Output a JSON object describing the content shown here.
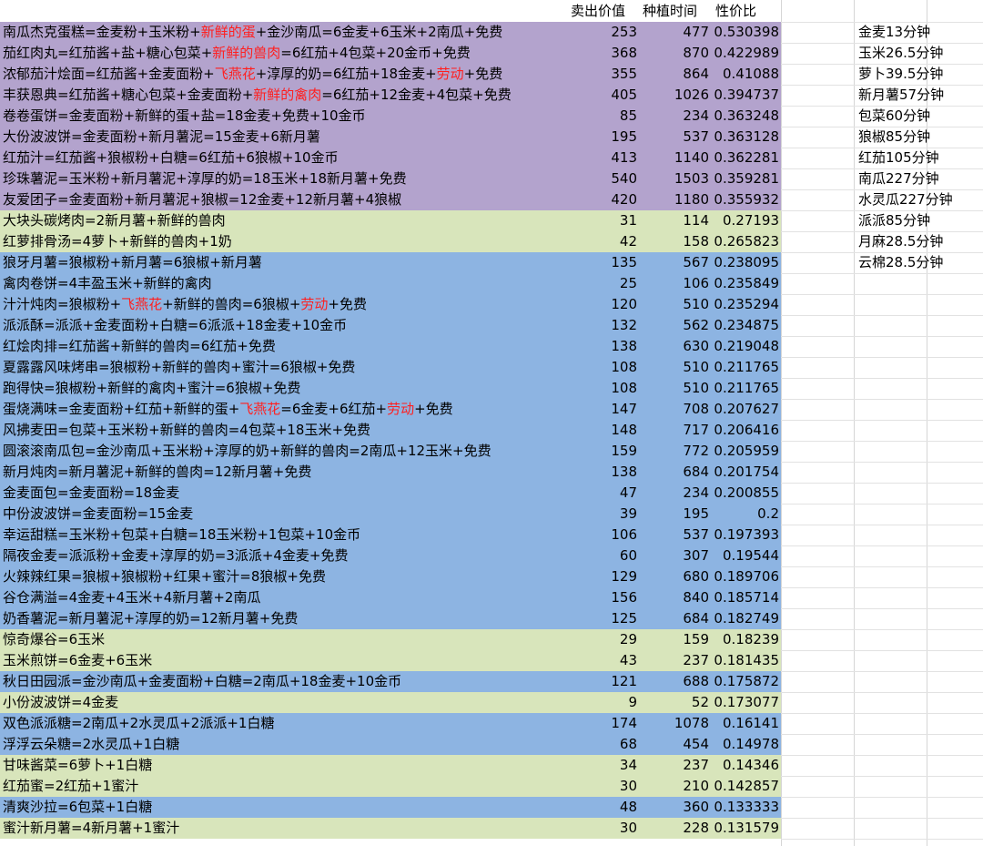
{
  "colors": {
    "purple": "#b3a3cd",
    "green": "#d8e5bb",
    "blue": "#8db4e2",
    "highlight_text": "#ff1f1f",
    "grid": "#d6d6d6"
  },
  "headers": {
    "price": "卖出价值",
    "time": "种植时间",
    "ratio": "性价比"
  },
  "rows": [
    {
      "color": "purple",
      "segments": [
        {
          "t": "南瓜杰克蛋糕=金麦粉+玉米粉+"
        },
        {
          "t": "新鲜的蛋",
          "red": true
        },
        {
          "t": "+金沙南瓜=6金麦+6玉米+2南瓜+免费"
        }
      ],
      "price": "253",
      "time": "477",
      "ratio": "0.530398"
    },
    {
      "color": "purple",
      "segments": [
        {
          "t": "茄红肉丸=红茄酱+盐+糖心包菜+"
        },
        {
          "t": "新鲜的兽肉",
          "red": true
        },
        {
          "t": "=6红茄+4包菜+20金币+免费"
        }
      ],
      "price": "368",
      "time": "870",
      "ratio": "0.422989"
    },
    {
      "color": "purple",
      "segments": [
        {
          "t": "浓郁茄汁烩面=红茄酱+金麦面粉+"
        },
        {
          "t": "飞燕花",
          "red": true
        },
        {
          "t": "+淳厚的奶=6红茄+18金麦+"
        },
        {
          "t": "劳动",
          "red": true
        },
        {
          "t": "+免费"
        }
      ],
      "price": "355",
      "time": "864",
      "ratio": "0.41088"
    },
    {
      "color": "purple",
      "segments": [
        {
          "t": "丰获恩典=红茄酱+糖心包菜+金麦面粉+"
        },
        {
          "t": "新鲜的禽肉",
          "red": true
        },
        {
          "t": "=6红茄+12金麦+4包菜+免费"
        }
      ],
      "price": "405",
      "time": "1026",
      "ratio": "0.394737"
    },
    {
      "color": "purple",
      "segments": [
        {
          "t": "卷卷蛋饼=金麦面粉+新鲜的蛋+盐=18金麦+免费+10金币"
        }
      ],
      "price": "85",
      "time": "234",
      "ratio": "0.363248"
    },
    {
      "color": "purple",
      "segments": [
        {
          "t": "大份波波饼=金麦面粉+新月薯泥=15金麦+6新月薯"
        }
      ],
      "price": "195",
      "time": "537",
      "ratio": "0.363128"
    },
    {
      "color": "purple",
      "segments": [
        {
          "t": "红茄汁=红茄酱+狼椒粉+白糖=6红茄+6狼椒+10金币"
        }
      ],
      "price": "413",
      "time": "1140",
      "ratio": "0.362281"
    },
    {
      "color": "purple",
      "segments": [
        {
          "t": "珍珠薯泥=玉米粉+新月薯泥+淳厚的奶=18玉米+18新月薯+免费"
        }
      ],
      "price": "540",
      "time": "1503",
      "ratio": "0.359281"
    },
    {
      "color": "purple",
      "segments": [
        {
          "t": "友爱团子=金麦面粉+新月薯泥+狼椒=12金麦+12新月薯+4狼椒"
        }
      ],
      "price": "420",
      "time": "1180",
      "ratio": "0.355932"
    },
    {
      "color": "green",
      "segments": [
        {
          "t": "大块头碳烤肉=2新月薯+新鲜的兽肉"
        }
      ],
      "price": "31",
      "time": "114",
      "ratio": "0.27193"
    },
    {
      "color": "green",
      "segments": [
        {
          "t": "红萝排骨汤=4萝卜+新鲜的兽肉+1奶"
        }
      ],
      "price": "42",
      "time": "158",
      "ratio": "0.265823"
    },
    {
      "color": "blue",
      "segments": [
        {
          "t": "狼牙月薯=狼椒粉+新月薯=6狼椒+新月薯"
        }
      ],
      "price": "135",
      "time": "567",
      "ratio": "0.238095"
    },
    {
      "color": "blue",
      "segments": [
        {
          "t": "禽肉卷饼=4丰盈玉米+新鲜的禽肉"
        }
      ],
      "price": "25",
      "time": "106",
      "ratio": "0.235849"
    },
    {
      "color": "blue",
      "segments": [
        {
          "t": "汁汁炖肉=狼椒粉+"
        },
        {
          "t": "飞燕花",
          "red": true
        },
        {
          "t": "+新鲜的兽肉=6狼椒+"
        },
        {
          "t": "劳动",
          "red": true
        },
        {
          "t": "+免费"
        }
      ],
      "price": "120",
      "time": "510",
      "ratio": "0.235294"
    },
    {
      "color": "blue",
      "segments": [
        {
          "t": "派派酥=派派+金麦面粉+白糖=6派派+18金麦+10金币"
        }
      ],
      "price": "132",
      "time": "562",
      "ratio": "0.234875"
    },
    {
      "color": "blue",
      "segments": [
        {
          "t": "红烩肉排=红茄酱+新鲜的兽肉=6红茄+免费"
        }
      ],
      "price": "138",
      "time": "630",
      "ratio": "0.219048"
    },
    {
      "color": "blue",
      "segments": [
        {
          "t": "夏露露风味烤串=狼椒粉+新鲜的兽肉+蜜汁=6狼椒+免费"
        }
      ],
      "price": "108",
      "time": "510",
      "ratio": "0.211765"
    },
    {
      "color": "blue",
      "segments": [
        {
          "t": "跑得快=狼椒粉+新鲜的禽肉+蜜汁=6狼椒+免费"
        }
      ],
      "price": "108",
      "time": "510",
      "ratio": "0.211765"
    },
    {
      "color": "blue",
      "segments": [
        {
          "t": "蛋烧满味=金麦面粉+红茄+新鲜的蛋+"
        },
        {
          "t": "飞燕花",
          "red": true
        },
        {
          "t": "=6金麦+6红茄+"
        },
        {
          "t": "劳动",
          "red": true
        },
        {
          "t": "+免费"
        }
      ],
      "price": "147",
      "time": "708",
      "ratio": "0.207627"
    },
    {
      "color": "blue",
      "segments": [
        {
          "t": "风拂麦田=包菜+玉米粉+新鲜的兽肉=4包菜+18玉米+免费"
        }
      ],
      "price": "148",
      "time": "717",
      "ratio": "0.206416"
    },
    {
      "color": "blue",
      "segments": [
        {
          "t": "圆滚滚南瓜包=金沙南瓜+玉米粉+淳厚的奶+新鲜的兽肉=2南瓜+12玉米+免费"
        }
      ],
      "price": "159",
      "time": "772",
      "ratio": "0.205959"
    },
    {
      "color": "blue",
      "segments": [
        {
          "t": "新月炖肉=新月薯泥+新鲜的兽肉=12新月薯+免费"
        }
      ],
      "price": "138",
      "time": "684",
      "ratio": "0.201754"
    },
    {
      "color": "blue",
      "segments": [
        {
          "t": "金麦面包=金麦面粉=18金麦"
        }
      ],
      "price": "47",
      "time": "234",
      "ratio": "0.200855"
    },
    {
      "color": "blue",
      "segments": [
        {
          "t": "中份波波饼=金麦面粉=15金麦"
        }
      ],
      "price": "39",
      "time": "195",
      "ratio": "0.2"
    },
    {
      "color": "blue",
      "segments": [
        {
          "t": "幸运甜糕=玉米粉+包菜+白糖=18玉米粉+1包菜+10金币"
        }
      ],
      "price": "106",
      "time": "537",
      "ratio": "0.197393"
    },
    {
      "color": "blue",
      "segments": [
        {
          "t": "隔夜金麦=派派粉+金麦+淳厚的奶=3派派+4金麦+免费"
        }
      ],
      "price": "60",
      "time": "307",
      "ratio": "0.19544"
    },
    {
      "color": "blue",
      "segments": [
        {
          "t": "火辣辣红果=狼椒+狼椒粉+红果+蜜汁=8狼椒+免费"
        }
      ],
      "price": "129",
      "time": "680",
      "ratio": "0.189706"
    },
    {
      "color": "blue",
      "segments": [
        {
          "t": "谷仓满溢=4金麦+4玉米+4新月薯+2南瓜"
        }
      ],
      "price": "156",
      "time": "840",
      "ratio": "0.185714"
    },
    {
      "color": "blue",
      "segments": [
        {
          "t": "奶香薯泥=新月薯泥+淳厚的奶=12新月薯+免费"
        }
      ],
      "price": "125",
      "time": "684",
      "ratio": "0.182749"
    },
    {
      "color": "green",
      "segments": [
        {
          "t": "惊奇爆谷=6玉米"
        }
      ],
      "price": "29",
      "time": "159",
      "ratio": "0.18239"
    },
    {
      "color": "green",
      "segments": [
        {
          "t": "玉米煎饼=6金麦+6玉米"
        }
      ],
      "price": "43",
      "time": "237",
      "ratio": "0.181435"
    },
    {
      "color": "blue",
      "segments": [
        {
          "t": "秋日田园派=金沙南瓜+金麦面粉+白糖=2南瓜+18金麦+10金币"
        }
      ],
      "price": "121",
      "time": "688",
      "ratio": "0.175872"
    },
    {
      "color": "green",
      "segments": [
        {
          "t": "小份波波饼=4金麦"
        }
      ],
      "price": "9",
      "time": "52",
      "ratio": "0.173077"
    },
    {
      "color": "blue",
      "segments": [
        {
          "t": "双色派派糖=2南瓜+2水灵瓜+2派派+1白糖"
        }
      ],
      "price": "174",
      "time": "1078",
      "ratio": "0.16141"
    },
    {
      "color": "blue",
      "segments": [
        {
          "t": "浮浮云朵糖=2水灵瓜+1白糖"
        }
      ],
      "price": "68",
      "time": "454",
      "ratio": "0.14978"
    },
    {
      "color": "green",
      "segments": [
        {
          "t": "甘味酱菜=6萝卜+1白糖"
        }
      ],
      "price": "34",
      "time": "237",
      "ratio": "0.14346"
    },
    {
      "color": "green",
      "segments": [
        {
          "t": "红茄蜜=2红茄+1蜜汁"
        }
      ],
      "price": "30",
      "time": "210",
      "ratio": "0.142857"
    },
    {
      "color": "blue",
      "segments": [
        {
          "t": "清爽沙拉=6包菜+1白糖"
        }
      ],
      "price": "48",
      "time": "360",
      "ratio": "0.133333"
    },
    {
      "color": "green",
      "segments": [
        {
          "t": "蜜汁新月薯=4新月薯+1蜜汁"
        }
      ],
      "price": "30",
      "time": "228",
      "ratio": "0.131579"
    }
  ],
  "crop_times": [
    "金麦13分钟",
    "玉米26.5分钟",
    "萝卜39.5分钟",
    "新月薯57分钟",
    "包菜60分钟",
    "狼椒85分钟",
    "红茄105分钟",
    "南瓜227分钟",
    "水灵瓜227分钟",
    "派派85分钟",
    "月麻28.5分钟",
    "云棉28.5分钟"
  ]
}
